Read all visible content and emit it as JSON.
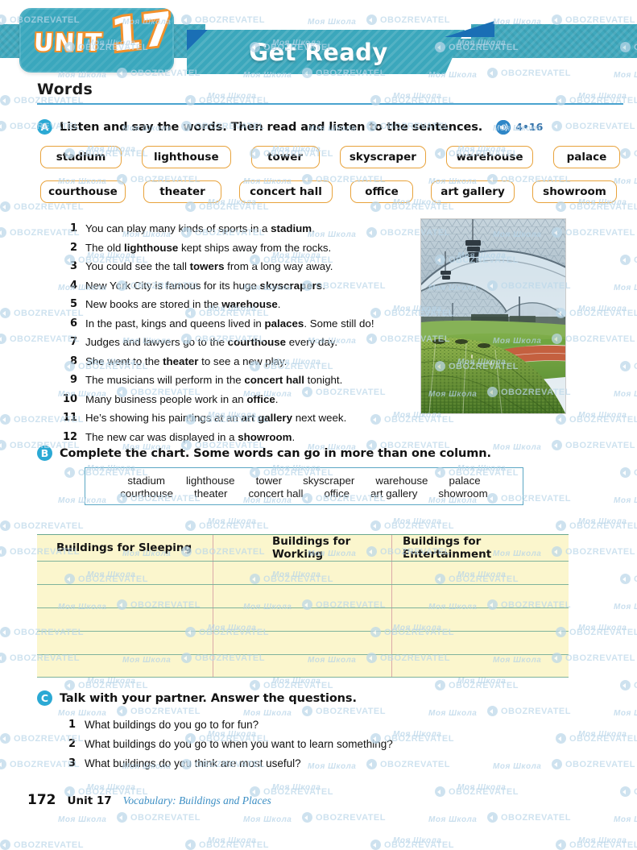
{
  "header": {
    "unit_word": "UNIT",
    "unit_number": "17",
    "banner_title": "Get Ready"
  },
  "section_heading": "Words",
  "tasks": {
    "a": {
      "letter": "A",
      "instruction": "Listen and say the words. Then read and listen to the sentences.",
      "audio_icon": "audio-speaker-icon",
      "audio_track": "4•16"
    },
    "b": {
      "letter": "B",
      "instruction": "Complete the chart. Some words can go in more than one column."
    },
    "c": {
      "letter": "C",
      "instruction": "Talk with your partner. Answer the questions."
    }
  },
  "word_chips": {
    "row1": [
      "stadium",
      "lighthouse",
      "tower",
      "skyscraper",
      "warehouse",
      "palace"
    ],
    "row2": [
      "courthouse",
      "theater",
      "concert hall",
      "office",
      "art gallery",
      "showroom"
    ]
  },
  "sentences": [
    {
      "n": "1",
      "pre": "You can play many kinds of sports in a ",
      "bold": "stadium",
      "post": "."
    },
    {
      "n": "2",
      "pre": "The old ",
      "bold": "lighthouse",
      "post": " kept ships away from the rocks."
    },
    {
      "n": "3",
      "pre": "You could see the tall ",
      "bold": "towers",
      "post": " from a long way away."
    },
    {
      "n": "4",
      "pre": "New York City is famous for its huge ",
      "bold": "skyscrapers",
      "post": "."
    },
    {
      "n": "5",
      "pre": "New books are stored in the ",
      "bold": "warehouse",
      "post": "."
    },
    {
      "n": "6",
      "pre": "In the past, kings and queens lived in ",
      "bold": "palaces",
      "post": ". Some still do!"
    },
    {
      "n": "7",
      "pre": "Judges and lawyers go to the ",
      "bold": "courthouse",
      "post": " every day."
    },
    {
      "n": "8",
      "pre": "She went to the ",
      "bold": "theater",
      "post": " to see a new play."
    },
    {
      "n": "9",
      "pre": "The musicians will perform in the ",
      "bold": "concert hall",
      "post": " tonight."
    },
    {
      "n": "10",
      "pre": "Many business people work in an ",
      "bold": "office",
      "post": "."
    },
    {
      "n": "11",
      "pre": "He’s showing his paintings at an ",
      "bold": "art gallery",
      "post": " next week."
    },
    {
      "n": "12",
      "pre": "The new car was displayed in a ",
      "bold": "showroom",
      "post": "."
    }
  ],
  "photo": {
    "alt": "stadium-photo",
    "caption": ""
  },
  "word_bank": {
    "row1": [
      "stadium",
      "lighthouse",
      "tower",
      "skyscraper",
      "warehouse",
      "palace"
    ],
    "row2": [
      "courthouse",
      "theater",
      "concert hall",
      "office",
      "art gallery",
      "showroom"
    ]
  },
  "chart_table": {
    "columns": [
      "Buildings for Sleeping",
      "Buildings for Working",
      "Buildings for Entertainment"
    ],
    "rows": [
      [
        "",
        "",
        ""
      ],
      [
        "",
        "",
        ""
      ],
      [
        "",
        "",
        ""
      ],
      [
        "",
        "",
        ""
      ],
      [
        "",
        "",
        ""
      ]
    ]
  },
  "questions": [
    {
      "n": "1",
      "text": "What buildings do you go to for fun?"
    },
    {
      "n": "2",
      "text": "What buildings do you go to when you want to learn something?"
    },
    {
      "n": "3",
      "text": "What buildings do you think are most useful?"
    }
  ],
  "footer": {
    "page_number": "172",
    "unit_label": "Unit 17",
    "topic": "Vocabulary: Buildings and Places"
  },
  "watermark": {
    "brand": "OBOZREVATEL",
    "school": "Моя Школа"
  },
  "colors": {
    "banner_teal": "#3ba7bc",
    "banner_blue_fold": "#1a6fb5",
    "unit_orange": "#f2912c",
    "chip_border": "#e8a33c",
    "circle_blue": "#2ba9d4",
    "rule_blue": "#4aa3cf",
    "chart_yellow": "#fbf6cd",
    "chart_rowline": "#7fb39c",
    "chart_colline": "#dba9a9",
    "bank_border": "#5ba7c4",
    "footer_topic": "#3d8fc4"
  }
}
